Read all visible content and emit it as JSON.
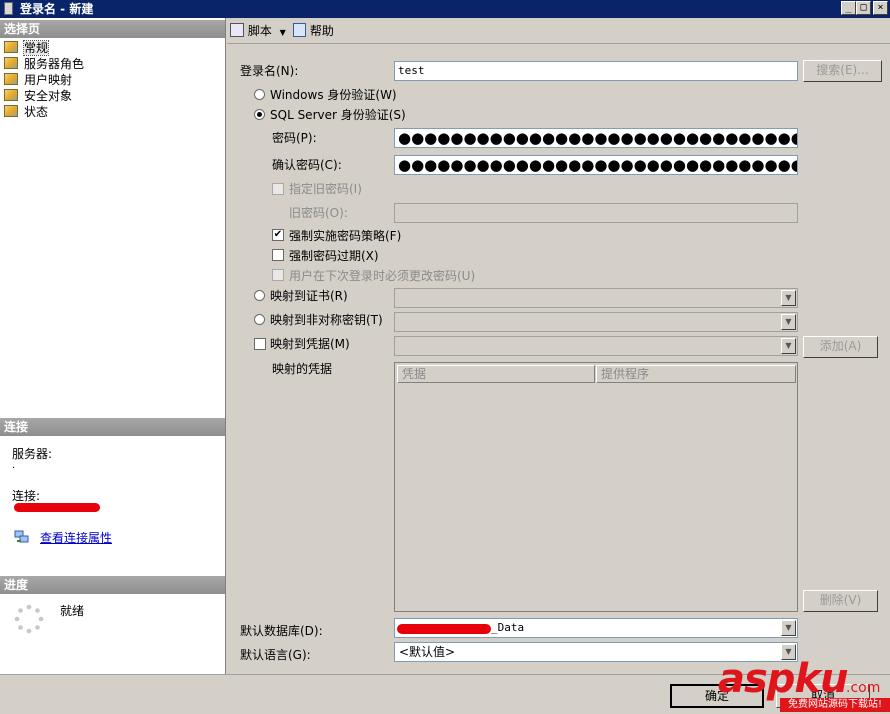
{
  "window": {
    "title": "登录名 - 新建",
    "controls": [
      "_",
      "□",
      "×"
    ]
  },
  "left": {
    "select_page_header": "选择页",
    "pages": [
      {
        "label": "常规",
        "selected": true
      },
      {
        "label": "服务器角色",
        "selected": false
      },
      {
        "label": "用户映射",
        "selected": false
      },
      {
        "label": "安全对象",
        "selected": false
      },
      {
        "label": "状态",
        "selected": false
      }
    ],
    "connection_header": "连接",
    "server_label": "服务器:",
    "server_value": ".",
    "connection_label": "连接:",
    "view_connection_link": "查看连接属性",
    "progress_header": "进度",
    "progress_status": "就绪"
  },
  "toolbar": {
    "script_label": "脚本",
    "help_label": "帮助"
  },
  "form": {
    "login_name_label": "登录名(N):",
    "login_name_value": "test",
    "search_button": "搜索(E)...",
    "windows_auth_label": "Windows 身份验证(W)",
    "sql_auth_label": "SQL Server 身份验证(S)",
    "password_label": "密码(P):",
    "password_value": "●●●●●●●●●●●●●●●●●●●●●●●●●●●●●●●",
    "confirm_password_label": "确认密码(C):",
    "confirm_password_value": "●●●●●●●●●●●●●●●●●●●●●●●●●●●●●●●",
    "specify_old_password_label": "指定旧密码(I)",
    "old_password_label": "旧密码(O):",
    "enforce_policy_label": "强制实施密码策略(F)",
    "enforce_policy_checked": true,
    "enforce_expiration_label": "强制密码过期(X)",
    "must_change_label": "用户在下次登录时必须更改密码(U)",
    "map_certificate_label": "映射到证书(R)",
    "map_asym_key_label": "映射到非对称密钥(T)",
    "map_credential_label": "映射到凭据(M)",
    "add_button": "添加(A)",
    "mapped_credentials_label": "映射的凭据",
    "grid_columns": [
      "凭据",
      "提供程序"
    ],
    "remove_button": "删除(V)",
    "default_database_label": "默认数据库(D):",
    "default_database_value": "_Data",
    "default_language_label": "默认语言(G):",
    "default_language_value": "<默认值>"
  },
  "footer": {
    "ok_button": "确定",
    "cancel_button": "取消"
  },
  "watermark": {
    "brand": "aspku",
    "suffix": ".com",
    "tagline": "免费网站源码下载站!"
  },
  "colors": {
    "title_bar": "#0a246a",
    "section_header": "#999999",
    "link": "#0000cc",
    "redaction": "#e8000a",
    "watermark_red": "#e0151b"
  }
}
